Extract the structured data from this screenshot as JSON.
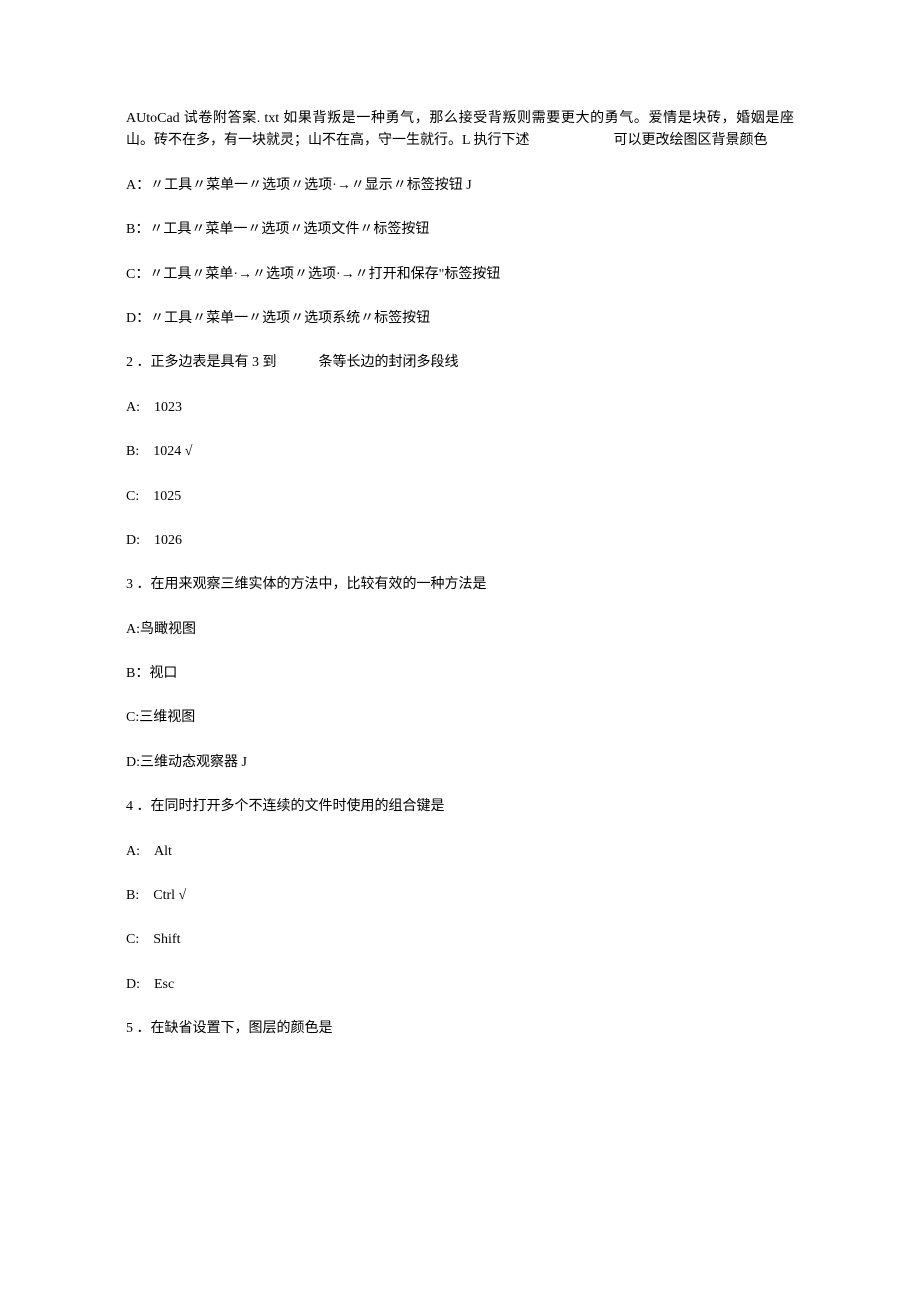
{
  "intro": "AUtoCad 试卷附答案. txt 如果背叛是一种勇气，那么接受背叛则需要更大的勇气。爱情是块砖，婚姻是座山。砖不在多，有一块就灵；山不在高，守一生就行。L 执行下述　　　　　　可以更改绘图区背景颜色",
  "q1": {
    "a": "A：〃工具〃菜单一〃选项〃选项·→〃显示〃标签按钮 J",
    "b": "B：〃工具〃菜单一〃选项〃选项文件〃标签按钮",
    "c": "C：〃工具〃菜单·→〃选项〃选项·→〃打开和保存\"标签按钮",
    "d": "D：〃工具〃菜单一〃选项〃选项系统〃标签按钮"
  },
  "q2": {
    "stem": "2 ．正多边表是具有 3 到　　　条等长边的封闭多段线",
    "a": "A:　1023",
    "b": "B:　1024 √",
    "c": "C:　1025",
    "d": "D:　1026"
  },
  "q3": {
    "stem": "3 ．在用来观察三维实体的方法中，比较有效的一种方法是",
    "a": "A:鸟瞰视图",
    "b": "B：视口",
    "c": "C:三维视图",
    "d": "D:三维动态观察器 J"
  },
  "q4": {
    "stem": "4 ．在同时打开多个不连续的文件时使用的组合键是",
    "a": "A:　Alt",
    "b": "B:　Ctrl √",
    "c": "C:　Shift",
    "d": "D:　Esc"
  },
  "q5": {
    "stem": "5 ．在缺省设置下，图层的颜色是"
  }
}
